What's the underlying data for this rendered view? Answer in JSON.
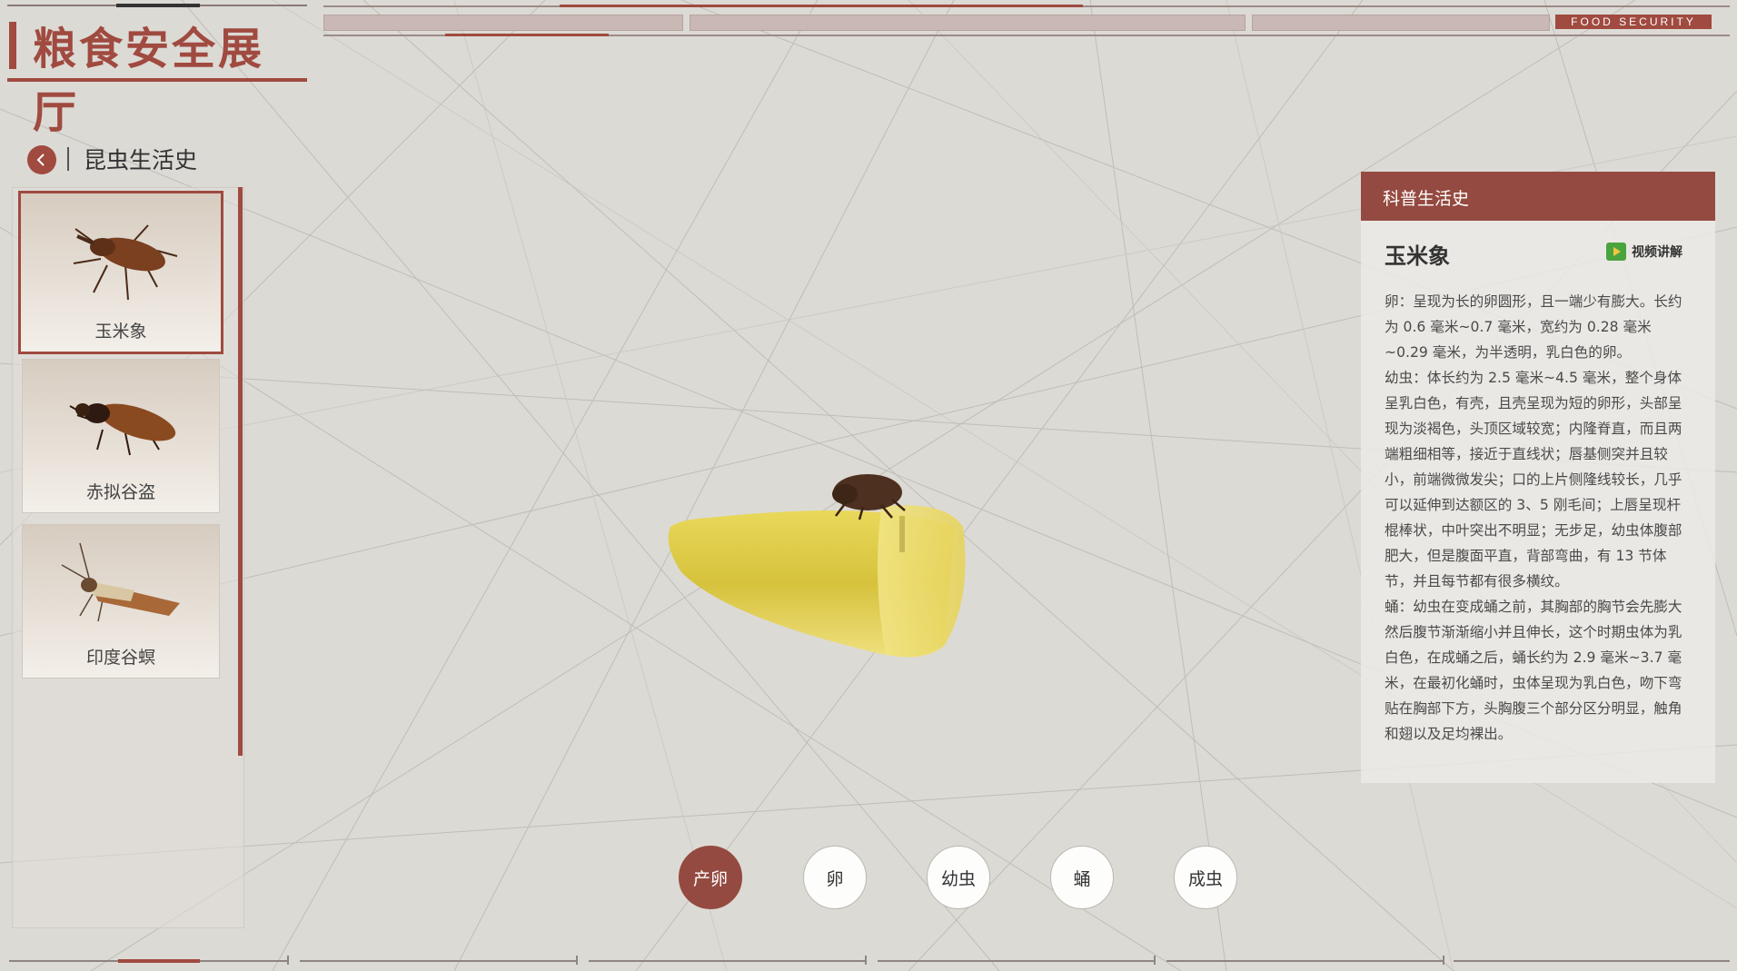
{
  "header": {
    "title": "粮食安全展厅",
    "tag": "FOOD SECURITY"
  },
  "section": {
    "title": "昆虫生活史",
    "back_icon": "chevron-left-icon"
  },
  "insects": [
    {
      "name": "玉米象",
      "selected": true
    },
    {
      "name": "赤拟谷盗",
      "selected": false
    },
    {
      "name": "印度谷螟",
      "selected": false
    }
  ],
  "info": {
    "header": "科普生活史",
    "name": "玉米象",
    "video_label": "视频讲解",
    "paragraphs": [
      "卵：呈现为长的卵圆形，且一端少有膨大。长约为 0.6 毫米~0.7 毫米，宽约为 0.28 毫米~0.29 毫米，为半透明，乳白色的卵。",
      "幼虫：体长约为 2.5 毫米~4.5 毫米，整个身体呈乳白色，有壳，且壳呈现为短的卵形，头部呈现为淡褐色，头顶区域较宽；内隆脊直，而且两端粗细相等，接近于直线状；唇基侧突并且较小，前端微微发尖；口的上片侧隆线较长，几乎可以延伸到达额区的 3、5 刚毛间；上唇呈现杆棍棒状，中叶突出不明显；无步足，幼虫体腹部肥大，但是腹面平直，背部弯曲，有 13 节体节，并且每节都有很多横纹。",
      "蛹：幼虫在变成蛹之前，其胸部的胸节会先膨大然后腹节渐渐缩小并且伸长，这个时期虫体为乳白色，在成蛹之后，蛹长约为 2.9 毫米~3.7 毫米，在最初化蛹时，虫体呈现为乳白色，吻下弯贴在胸部下方，头胸腹三个部分区分明显，触角和翅以及足均裸出。"
    ]
  },
  "stages": [
    {
      "label": "产卵",
      "active": true
    },
    {
      "label": "卵",
      "active": false
    },
    {
      "label": "幼虫",
      "active": false
    },
    {
      "label": "蛹",
      "active": false
    },
    {
      "label": "成虫",
      "active": false
    }
  ],
  "colors": {
    "accent": "#a04a40",
    "panel_header": "#944a40",
    "background": "#dcdad5"
  }
}
